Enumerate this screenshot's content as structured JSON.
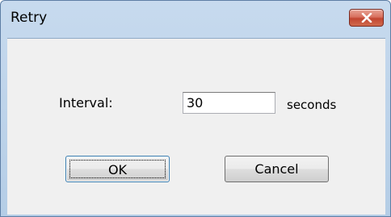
{
  "window": {
    "title": "Retry"
  },
  "form": {
    "interval_label": "Interval:",
    "interval_value": "30",
    "unit_label": "seconds"
  },
  "buttons": {
    "ok_label": "OK",
    "cancel_label": "Cancel"
  },
  "icons": {
    "close": "close-icon"
  },
  "colors": {
    "title_bar": "#c3d7ec",
    "close_button": "#c9503b",
    "client_area": "#f0f0f0"
  }
}
